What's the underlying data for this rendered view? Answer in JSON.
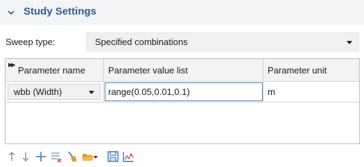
{
  "section": {
    "title": "Study Settings"
  },
  "sweep": {
    "label": "Sweep type:",
    "value": "Specified combinations"
  },
  "table": {
    "headers": [
      "Parameter name",
      "Parameter value list",
      "Parameter unit"
    ],
    "rows": [
      {
        "name": "wbb (Width)",
        "values": "range(0.05,0.01,0.1)",
        "unit": "m"
      }
    ]
  },
  "toolbar": {
    "icons": [
      "move-up-icon",
      "move-down-icon",
      "add-icon",
      "clear-table-icon",
      "delete-icon",
      "load-from-file-icon",
      "save-to-file-icon",
      "plot-icon"
    ]
  },
  "colors": {
    "accent": "#2d5d8e",
    "focus": "#3b82c4",
    "add": "#3a7bd5",
    "delete": "#e39d2a",
    "folder": "#e89b1c"
  }
}
